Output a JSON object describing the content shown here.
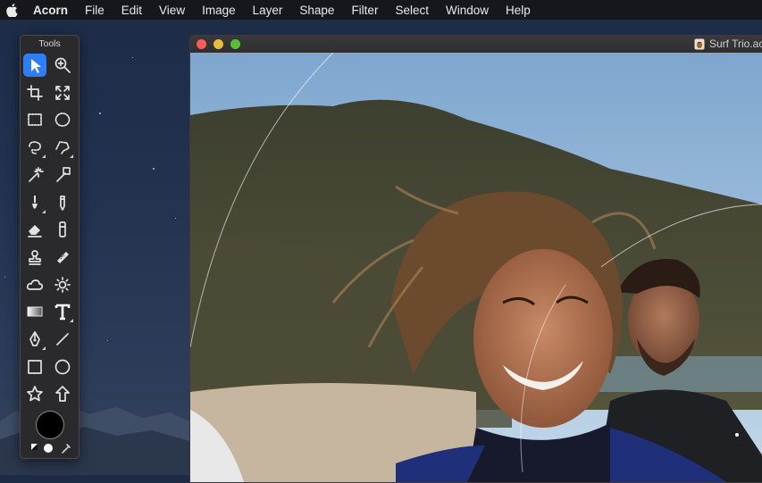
{
  "menubar": {
    "apple_icon": "apple-icon",
    "app_name": "Acorn",
    "items": [
      "File",
      "Edit",
      "View",
      "Image",
      "Layer",
      "Shape",
      "Filter",
      "Select",
      "Window",
      "Help"
    ]
  },
  "tools_palette": {
    "title": "Tools",
    "tools": [
      "select-arrow-tool",
      "zoom-tool",
      "crop-tool",
      "transform-tool",
      "rect-marquee-tool",
      "oval-marquee-tool",
      "lasso-tool",
      "polygon-lasso-tool",
      "magic-wand-tool",
      "magic-selection-tool",
      "brush-tool",
      "pencil-tool",
      "eraser-tool",
      "smudge-tool",
      "clone-stamp-tool",
      "healing-tool",
      "cloud-tool",
      "light-tool",
      "gradient-tool",
      "text-tool",
      "bezier-pen-tool",
      "line-tool",
      "rectangle-shape-tool",
      "oval-shape-tool",
      "star-shape-tool",
      "arrow-shape-tool"
    ],
    "active_tool": "select-arrow-tool",
    "color_well": "#000000"
  },
  "document_window": {
    "title": "Surf Trio.ac",
    "traffic_lights": {
      "close": "#fc5b57",
      "minimize": "#e5bf3c",
      "zoom": "#57c038"
    }
  }
}
